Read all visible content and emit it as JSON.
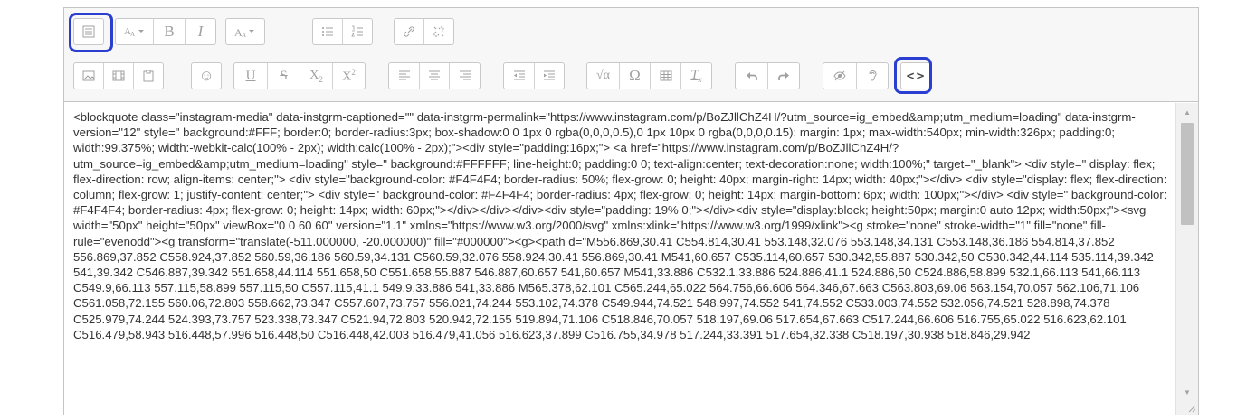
{
  "toolbar": {
    "row1": [
      "toolbar-toggle-icon",
      "font-family-icon",
      "bold-icon",
      "italic-icon",
      "font-size-icon",
      "bullet-list-icon",
      "numbered-list-icon",
      "link-icon",
      "unlink-icon"
    ],
    "row2": [
      "image-icon",
      "media-icon",
      "paste-icon",
      "emoticon-icon",
      "underline-icon",
      "strikethrough-icon",
      "subscript-icon",
      "superscript-icon",
      "align-left-icon",
      "align-center-icon",
      "align-right-icon",
      "outdent-icon",
      "indent-icon",
      "equation-icon",
      "special-character-icon",
      "table-icon",
      "clear-formatting-icon",
      "undo-icon",
      "redo-icon",
      "accessibility-checker-icon",
      "screenreader-helper-icon",
      "html-source-icon"
    ],
    "glyphs": {
      "bold": "B",
      "italic": "I",
      "underline": "U",
      "strike": "S",
      "sub": "X",
      "sub_small": "2",
      "sup": "X",
      "sup_small": "2",
      "omega": "Ω",
      "clear": "T",
      "clear_small": "x",
      "emoji": "☺",
      "source": "<>",
      "sqrt": "√α"
    }
  },
  "highlight_color": "#2a3fd1",
  "editor": {
    "content": "<blockquote class=\"instagram-media\" data-instgrm-captioned=\"\" data-instgrm-permalink=\"https://www.instagram.com/p/BoZJllChZ4H/?utm_source=ig_embed&amp;utm_medium=loading\" data-instgrm-version=\"12\" style=\" background:#FFF; border:0; border-radius:3px; box-shadow:0 0 1px 0 rgba(0,0,0,0.5),0 1px 10px 0 rgba(0,0,0,0.15); margin: 1px; max-width:540px; min-width:326px; padding:0; width:99.375%; width:-webkit-calc(100% - 2px); width:calc(100% - 2px);\"><div style=\"padding:16px;\"> <a href=\"https://www.instagram.com/p/BoZJllChZ4H/?utm_source=ig_embed&amp;utm_medium=loading\" style=\" background:#FFFFFF; line-height:0; padding:0 0; text-align:center; text-decoration:none; width:100%;\" target=\"_blank\"> <div style=\" display: flex; flex-direction: row; align-items: center;\"> <div style=\"background-color: #F4F4F4; border-radius: 50%; flex-grow: 0; height: 40px; margin-right: 14px; width: 40px;\"></div> <div style=\"display: flex; flex-direction: column; flex-grow: 1; justify-content: center;\"> <div style=\" background-color: #F4F4F4; border-radius: 4px; flex-grow: 0; height: 14px; margin-bottom: 6px; width: 100px;\"></div> <div style=\" background-color: #F4F4F4; border-radius: 4px; flex-grow: 0; height: 14px; width: 60px;\"></div></div></div><div style=\"padding: 19% 0;\"></div><div style=\"display:block; height:50px; margin:0 auto 12px; width:50px;\"><svg width=\"50px\" height=\"50px\" viewBox=\"0 0 60 60\" version=\"1.1\" xmlns=\"https://www.w3.org/2000/svg\" xmlns:xlink=\"https://www.w3.org/1999/xlink\"><g stroke=\"none\" stroke-width=\"1\" fill=\"none\" fill-rule=\"evenodd\"><g transform=\"translate(-511.000000, -20.000000)\" fill=\"#000000\"><g><path d=\"M556.869,30.41 C554.814,30.41 553.148,32.076 553.148,34.131 C553.148,36.186 554.814,37.852 556.869,37.852 C558.924,37.852 560.59,36.186 560.59,34.131 C560.59,32.076 558.924,30.41 556.869,30.41 M541,60.657 C535.114,60.657 530.342,55.887 530.342,50 C530.342,44.114 535.114,39.342 541,39.342 C546.887,39.342 551.658,44.114 551.658,50 C551.658,55.887 546.887,60.657 541,60.657 M541,33.886 C532.1,33.886 524.886,41.1 524.886,50 C524.886,58.899 532.1,66.113 541,66.113 C549.9,66.113 557.115,58.899 557.115,50 C557.115,41.1 549.9,33.886 541,33.886 M565.378,62.101 C565.244,65.022 564.756,66.606 564.346,67.663 C563.803,69.06 563.154,70.057 562.106,71.106 C561.058,72.155 560.06,72.803 558.662,73.347 C557.607,73.757 556.021,74.244 553.102,74.378 C549.944,74.521 548.997,74.552 541,74.552 C533.003,74.552 532.056,74.521 528.898,74.378 C525.979,74.244 524.393,73.757 523.338,73.347 C521.94,72.803 520.942,72.155 519.894,71.106 C518.846,70.057 518.197,69.06 517.654,67.663 C517.244,66.606 516.755,65.022 516.623,62.101 C516.479,58.943 516.448,57.996 516.448,50 C516.448,42.003 516.479,41.056 516.623,37.899 C516.755,34.978 517.244,33.391 517.654,32.338 C518.197,30.938 518.846,29.942"
  }
}
